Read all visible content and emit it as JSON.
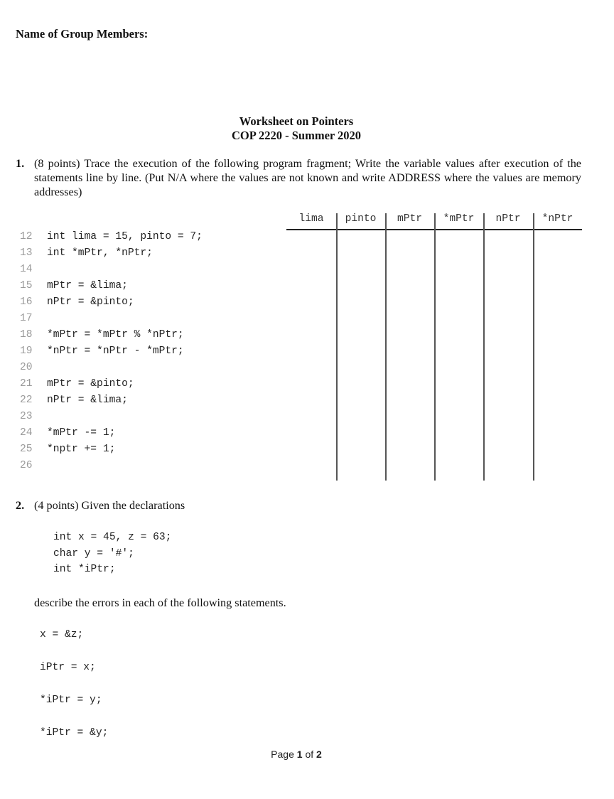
{
  "header": {
    "group_label": "Name of Group Members:"
  },
  "title": {
    "line1": "Worksheet on Pointers",
    "line2": "COP 2220 - Summer 2020"
  },
  "question1": {
    "number": "1.",
    "text": "(8 points) Trace the execution of the following program fragment; Write the variable values after execution of the statements line by line. (Put N/A where the values are not known and write ADDRESS where the values are memory addresses)",
    "code": [
      {
        "ln": "12",
        "src": "int lima = 15, pinto = 7;"
      },
      {
        "ln": "13",
        "src": "int *mPtr, *nPtr;"
      },
      {
        "ln": "14",
        "src": ""
      },
      {
        "ln": "15",
        "src": "mPtr = &lima;"
      },
      {
        "ln": "16",
        "src": "nPtr = &pinto;"
      },
      {
        "ln": "17",
        "src": ""
      },
      {
        "ln": "18",
        "src": "*mPtr = *mPtr % *nPtr;"
      },
      {
        "ln": "19",
        "src": "*nPtr = *nPtr - *mPtr;"
      },
      {
        "ln": "20",
        "src": ""
      },
      {
        "ln": "21",
        "src": "mPtr = &pinto;"
      },
      {
        "ln": "22",
        "src": "nPtr = &lima;"
      },
      {
        "ln": "23",
        "src": ""
      },
      {
        "ln": "24",
        "src": "*mPtr -= 1;"
      },
      {
        "ln": "25",
        "src": "*nptr += 1;"
      },
      {
        "ln": "26",
        "src": ""
      }
    ],
    "table_headers": [
      "lima",
      "pinto",
      "mPtr",
      "*mPtr",
      "nPtr",
      "*nPtr"
    ]
  },
  "question2": {
    "number": "2.",
    "text": "(4 points) Given the declarations",
    "declarations": [
      "int x = 45, z = 63;",
      "char y = '#';",
      "int *iPtr;"
    ],
    "instruction": "describe the errors in each of the following statements.",
    "statements": [
      "x = &z;",
      "iPtr = x;",
      "*iPtr = y;",
      "*iPtr = &y;"
    ]
  },
  "footer": {
    "page_word": "Page",
    "current_page": "1",
    "of_word": "of",
    "total_pages": "2"
  }
}
